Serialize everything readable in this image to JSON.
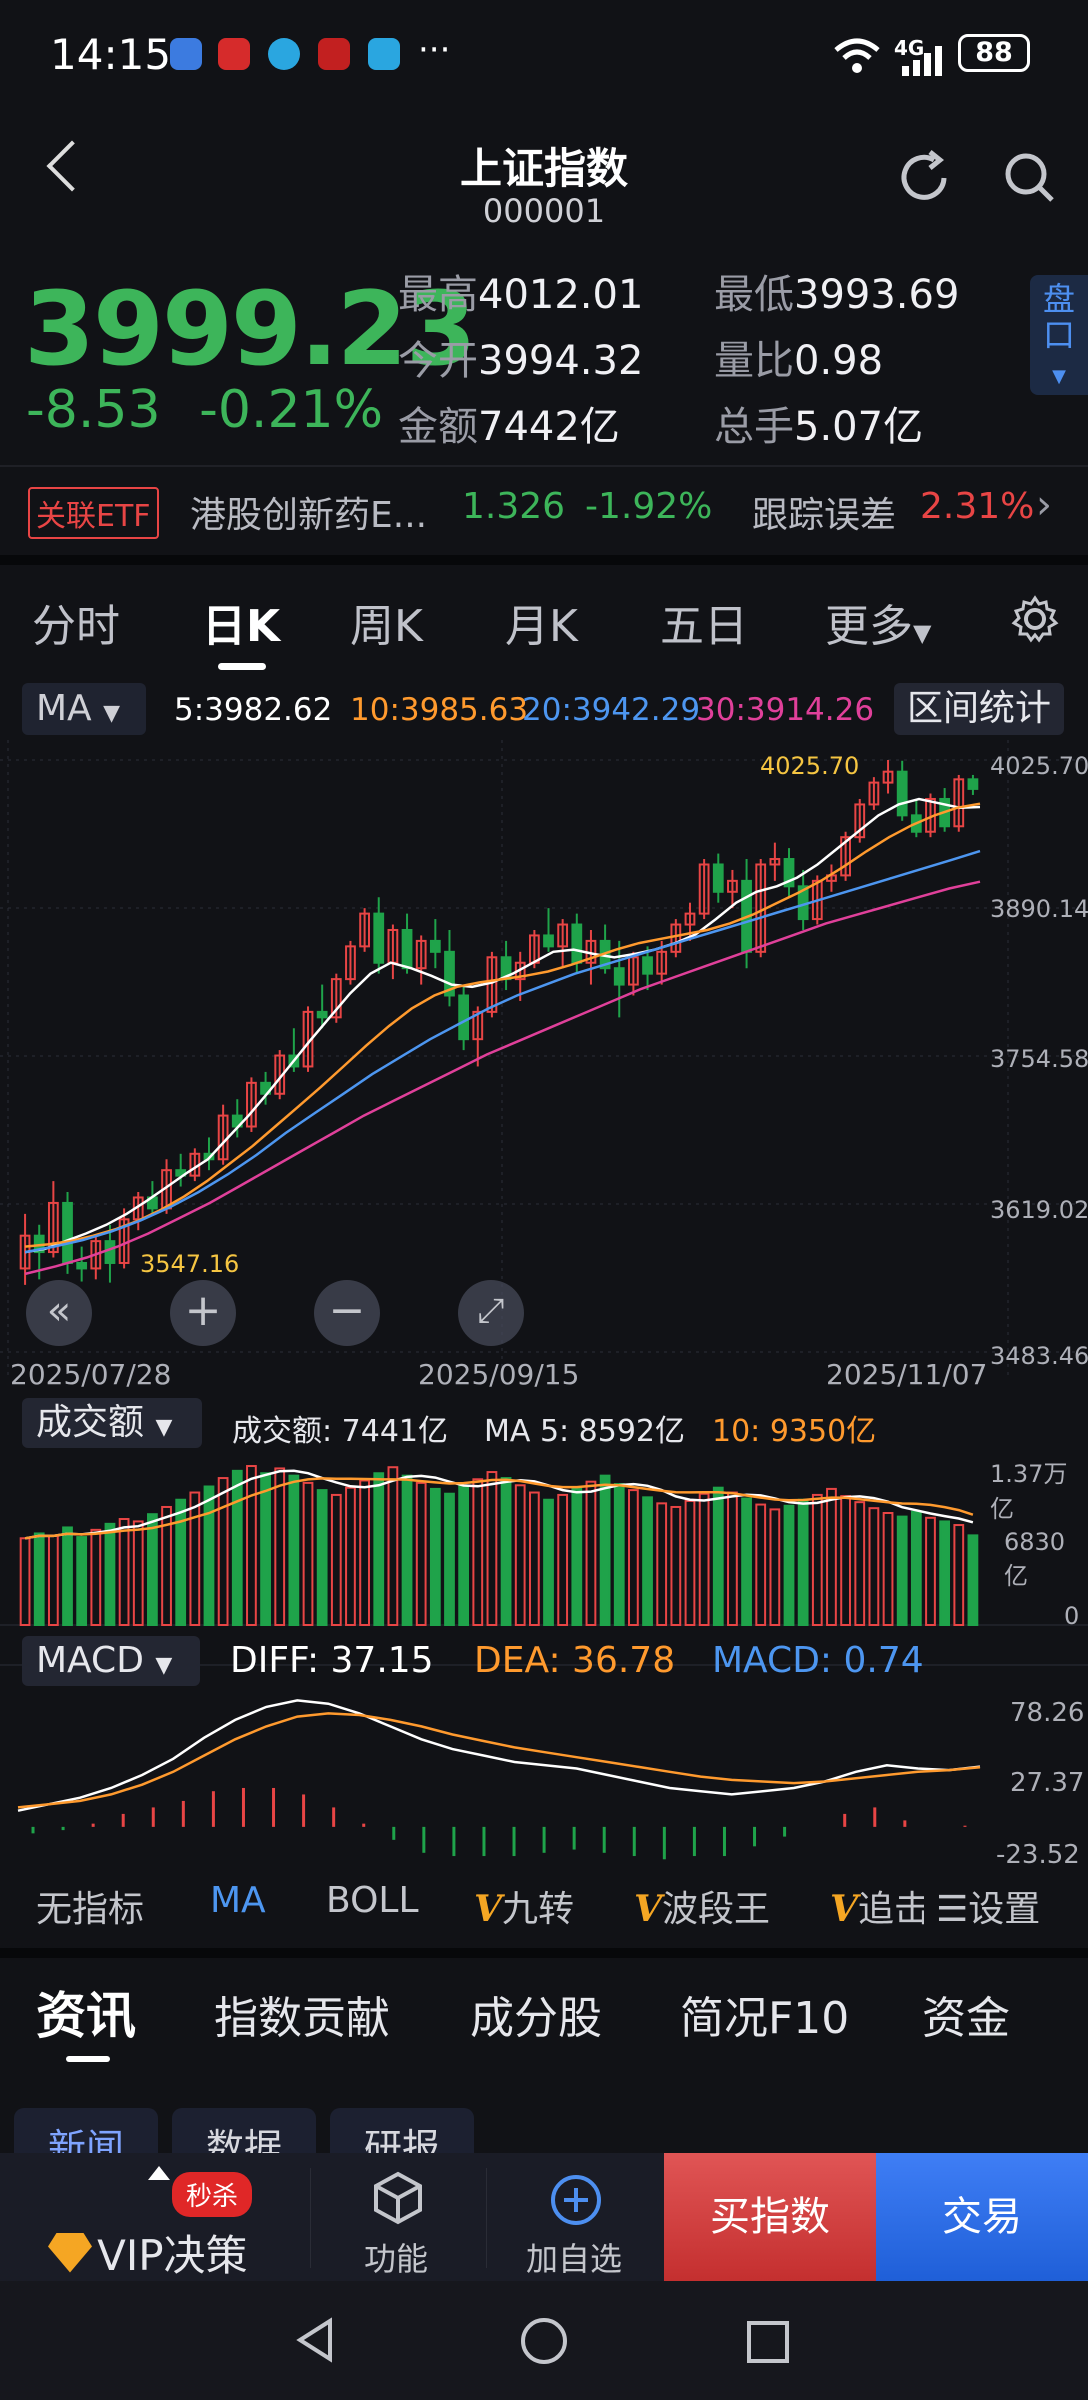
{
  "status_bar": {
    "time": "14:15",
    "network": "4G",
    "battery": "88",
    "app_icons": [
      "calendar-icon",
      "app-icon-red",
      "browser-icon",
      "app-icon-red2",
      "browser-icon-2"
    ],
    "more": "···"
  },
  "header": {
    "title": "上证指数",
    "code": "000001"
  },
  "quote": {
    "price": "3999.23",
    "change": "-8.53",
    "change_pct": "-0.21%",
    "high_label": "最高",
    "high": "4012.01",
    "low_label": "最低",
    "low": "3993.69",
    "open_label": "今开",
    "open": "3994.32",
    "ratio_label": "量比",
    "ratio": "0.98",
    "amount_label": "金额",
    "amount": "7442亿",
    "hands_label": "总手",
    "hands": "5.07亿",
    "pankou_label": "盘口"
  },
  "etf": {
    "tag": "关联ETF",
    "name": "港股创新药E...",
    "price": "1.326",
    "change_pct": "-1.92%",
    "tracking_label": "跟踪误差",
    "tracking_value": "2.31%"
  },
  "chart_tabs": [
    "分时",
    "日K",
    "周K",
    "月K",
    "五日",
    "更多"
  ],
  "active_tab": "日K",
  "ma_legend": {
    "selector": "MA",
    "ma5": "5:3982.62",
    "ma10": "10:3985.63",
    "ma20": "20:3942.29",
    "ma30": "30:3914.26",
    "range_button": "区间统计"
  },
  "colors": {
    "up": "#e84545",
    "down": "#1fa34a",
    "ma5": "#ffffff",
    "ma10": "#ff9a2e",
    "ma20": "#4d96f0",
    "ma30": "#e0409a",
    "price_down": "#3db55a",
    "accent_blue": "#4d8ff0",
    "annotation": "#f5c542"
  },
  "kline": {
    "y_ticks": [
      "4025.70",
      "3890.14",
      "3754.58",
      "3619.02",
      "3483.46"
    ],
    "x_labels": [
      "2025/07/28",
      "2025/09/15",
      "2025/11/07"
    ],
    "max_label": "4025.70",
    "min_label": "3547.16"
  },
  "volume": {
    "selector": "成交额",
    "value_text": "成交额: 7441亿",
    "ma5_text": "MA 5: 8592亿",
    "ma10_text": "10: 9350亿",
    "y_ticks": [
      "1.37万亿",
      "6830亿",
      "0"
    ]
  },
  "macd": {
    "selector": "MACD",
    "diff_text": "DIFF: 37.15",
    "dea_text": "DEA: 36.78",
    "macd_text": "MACD: 0.74",
    "y_ticks": [
      "78.26",
      "27.37",
      "-23.52"
    ]
  },
  "indicator_tabs": [
    "无指标",
    "MA",
    "BOLL",
    "九转",
    "波段王",
    "追击"
  ],
  "indicator_settings": "设置",
  "info_tabs": [
    "资讯",
    "指数贡献",
    "成分股",
    "简况F10",
    "资金"
  ],
  "info_subtabs": [
    "新闻",
    "数据",
    "研报"
  ],
  "action_bar": {
    "vip_badge": "秒杀",
    "vip_label": "VIP决策",
    "func_label": "功能",
    "watch_label": "加自选",
    "buy_label": "买指数",
    "trade_label": "交易"
  },
  "chart_data": {
    "type": "candlestick",
    "panels": [
      "price",
      "volume",
      "macd"
    ],
    "title": "上证指数",
    "ylim": [
      3483.46,
      4025.7
    ],
    "x_labels": [
      "2025/07/28",
      "2025/09/15",
      "2025/11/07"
    ],
    "ohlc": [
      [
        3560,
        3610,
        3545,
        3590
      ],
      [
        3590,
        3600,
        3550,
        3575
      ],
      [
        3575,
        3640,
        3570,
        3620
      ],
      [
        3620,
        3630,
        3555,
        3565
      ],
      [
        3565,
        3580,
        3548,
        3560
      ],
      [
        3560,
        3590,
        3550,
        3585
      ],
      [
        3585,
        3600,
        3547,
        3565
      ],
      [
        3565,
        3615,
        3560,
        3605
      ],
      [
        3605,
        3630,
        3595,
        3625
      ],
      [
        3625,
        3640,
        3610,
        3615
      ],
      [
        3615,
        3660,
        3610,
        3650
      ],
      [
        3650,
        3665,
        3635,
        3645
      ],
      [
        3645,
        3670,
        3640,
        3665
      ],
      [
        3665,
        3680,
        3650,
        3660
      ],
      [
        3660,
        3710,
        3655,
        3700
      ],
      [
        3700,
        3715,
        3680,
        3690
      ],
      [
        3690,
        3735,
        3685,
        3730
      ],
      [
        3730,
        3740,
        3710,
        3720
      ],
      [
        3720,
        3760,
        3715,
        3755
      ],
      [
        3755,
        3780,
        3740,
        3745
      ],
      [
        3745,
        3800,
        3740,
        3795
      ],
      [
        3795,
        3820,
        3780,
        3790
      ],
      [
        3790,
        3830,
        3785,
        3825
      ],
      [
        3825,
        3860,
        3820,
        3855
      ],
      [
        3855,
        3890,
        3850,
        3885
      ],
      [
        3885,
        3900,
        3830,
        3840
      ],
      [
        3840,
        3875,
        3825,
        3870
      ],
      [
        3870,
        3885,
        3830,
        3835
      ],
      [
        3835,
        3865,
        3820,
        3860
      ],
      [
        3860,
        3880,
        3835,
        3850
      ],
      [
        3850,
        3870,
        3800,
        3810
      ],
      [
        3810,
        3820,
        3760,
        3770
      ],
      [
        3770,
        3800,
        3745,
        3795
      ],
      [
        3795,
        3850,
        3790,
        3845
      ],
      [
        3845,
        3860,
        3815,
        3825
      ],
      [
        3825,
        3850,
        3805,
        3840
      ],
      [
        3840,
        3870,
        3835,
        3865
      ],
      [
        3865,
        3890,
        3850,
        3855
      ],
      [
        3855,
        3880,
        3835,
        3875
      ],
      [
        3875,
        3885,
        3830,
        3840
      ],
      [
        3840,
        3870,
        3820,
        3860
      ],
      [
        3860,
        3875,
        3830,
        3835
      ],
      [
        3835,
        3860,
        3790,
        3820
      ],
      [
        3820,
        3850,
        3810,
        3845
      ],
      [
        3845,
        3855,
        3815,
        3830
      ],
      [
        3830,
        3860,
        3820,
        3850
      ],
      [
        3850,
        3880,
        3845,
        3875
      ],
      [
        3875,
        3895,
        3860,
        3885
      ],
      [
        3885,
        3935,
        3880,
        3930
      ],
      [
        3930,
        3940,
        3895,
        3905
      ],
      [
        3905,
        3925,
        3890,
        3915
      ],
      [
        3915,
        3935,
        3835,
        3850
      ],
      [
        3850,
        3935,
        3845,
        3930
      ],
      [
        3930,
        3950,
        3915,
        3935
      ],
      [
        3935,
        3945,
        3900,
        3910
      ],
      [
        3910,
        3925,
        3870,
        3880
      ],
      [
        3880,
        3920,
        3875,
        3915
      ],
      [
        3915,
        3930,
        3905,
        3920
      ],
      [
        3920,
        3960,
        3915,
        3955
      ],
      [
        3955,
        3990,
        3950,
        3985
      ],
      [
        3985,
        4010,
        3980,
        4005
      ],
      [
        4005,
        4025.7,
        3995,
        4015
      ],
      [
        4015,
        4025,
        3970,
        3975
      ],
      [
        3975,
        3990,
        3955,
        3960
      ],
      [
        3960,
        3995,
        3955,
        3990
      ],
      [
        3990,
        4000,
        3960,
        3965
      ],
      [
        3965,
        4012,
        3960,
        4008
      ],
      [
        4008,
        4012.01,
        3993.69,
        3999.23
      ]
    ],
    "ma": {
      "ma5": [
        3575,
        3578,
        3585,
        3592,
        3600,
        3610,
        3622,
        3635,
        3648,
        3660,
        3680,
        3700,
        3722,
        3745,
        3768,
        3790,
        3812,
        3830,
        3840,
        3835,
        3828,
        3820,
        3818,
        3822,
        3830,
        3840,
        3850,
        3852,
        3848,
        3845,
        3848,
        3852,
        3858,
        3866,
        3880,
        3895,
        3905,
        3910,
        3918,
        3930,
        3945,
        3960,
        3975,
        3985,
        3990,
        3986,
        3982,
        3982.62
      ],
      "ma10": [
        3580,
        3582,
        3585,
        3590,
        3596,
        3604,
        3614,
        3626,
        3640,
        3656,
        3672,
        3690,
        3708,
        3726,
        3745,
        3764,
        3782,
        3798,
        3810,
        3818,
        3822,
        3825,
        3828,
        3832,
        3838,
        3845,
        3852,
        3858,
        3862,
        3866,
        3870,
        3876,
        3884,
        3894,
        3904,
        3915,
        3928,
        3942,
        3955,
        3966,
        3975,
        3982,
        3985.63
      ],
      "ma20": [
        3575,
        3580,
        3586,
        3594,
        3604,
        3616,
        3630,
        3646,
        3664,
        3684,
        3702,
        3720,
        3738,
        3754,
        3770,
        3784,
        3798,
        3810,
        3820,
        3830,
        3838,
        3846,
        3854,
        3862,
        3870,
        3878,
        3886,
        3894,
        3902,
        3910,
        3918,
        3926,
        3934,
        3942.29
      ],
      "ma30": [
        3555,
        3562,
        3570,
        3580,
        3592,
        3606,
        3620,
        3636,
        3652,
        3668,
        3684,
        3700,
        3714,
        3728,
        3742,
        3756,
        3768,
        3780,
        3792,
        3804,
        3816,
        3826,
        3836,
        3846,
        3856,
        3866,
        3876,
        3884,
        3892,
        3900,
        3908,
        3914.26
      ]
    },
    "volume": [
      7200,
      7600,
      7400,
      8100,
      7300,
      7900,
      8400,
      8800,
      8600,
      9200,
      9800,
      10400,
      11000,
      11500,
      12200,
      12800,
      13200,
      12600,
      13000,
      12400,
      11800,
      11200,
      10800,
      11400,
      12000,
      12600,
      13100,
      12400,
      11800,
      11300,
      10900,
      11500,
      12100,
      12700,
      12200,
      11600,
      11000,
      10400,
      10800,
      11300,
      11900,
      12400,
      11700,
      11200,
      10600,
      10100,
      9800,
      10300,
      10900,
      11400,
      11000,
      10500,
      10000,
      9600,
      9900,
      10400,
      10800,
      11300,
      10700,
      10200,
      9700,
      9300,
      9000,
      9400,
      8900,
      8600,
      8300,
      7441
    ],
    "volume_ma5": [
      8592
    ],
    "volume_ma10": [
      9350
    ],
    "macd": {
      "diff": [
        10,
        14,
        18,
        24,
        32,
        42,
        55,
        66,
        74,
        78,
        76,
        70,
        62,
        54,
        48,
        44,
        40,
        38,
        36,
        32,
        28,
        24,
        22,
        20,
        22,
        24,
        28,
        34,
        38,
        36,
        35,
        37.15
      ],
      "dea": [
        12,
        14,
        16,
        20,
        26,
        34,
        44,
        54,
        62,
        68,
        70,
        69,
        66,
        62,
        57,
        53,
        49,
        46,
        43,
        40,
        37,
        34,
        31,
        29,
        28,
        27,
        28,
        30,
        32,
        34,
        35,
        36.78
      ],
      "hist": [
        -4,
        -2,
        2,
        8,
        12,
        16,
        22,
        24,
        24,
        20,
        12,
        2,
        -8,
        -16,
        -18,
        -18,
        -18,
        -16,
        -14,
        -16,
        -18,
        -20,
        -18,
        -18,
        -12,
        -6,
        0,
        8,
        12,
        4,
        0,
        0.74
      ]
    }
  }
}
